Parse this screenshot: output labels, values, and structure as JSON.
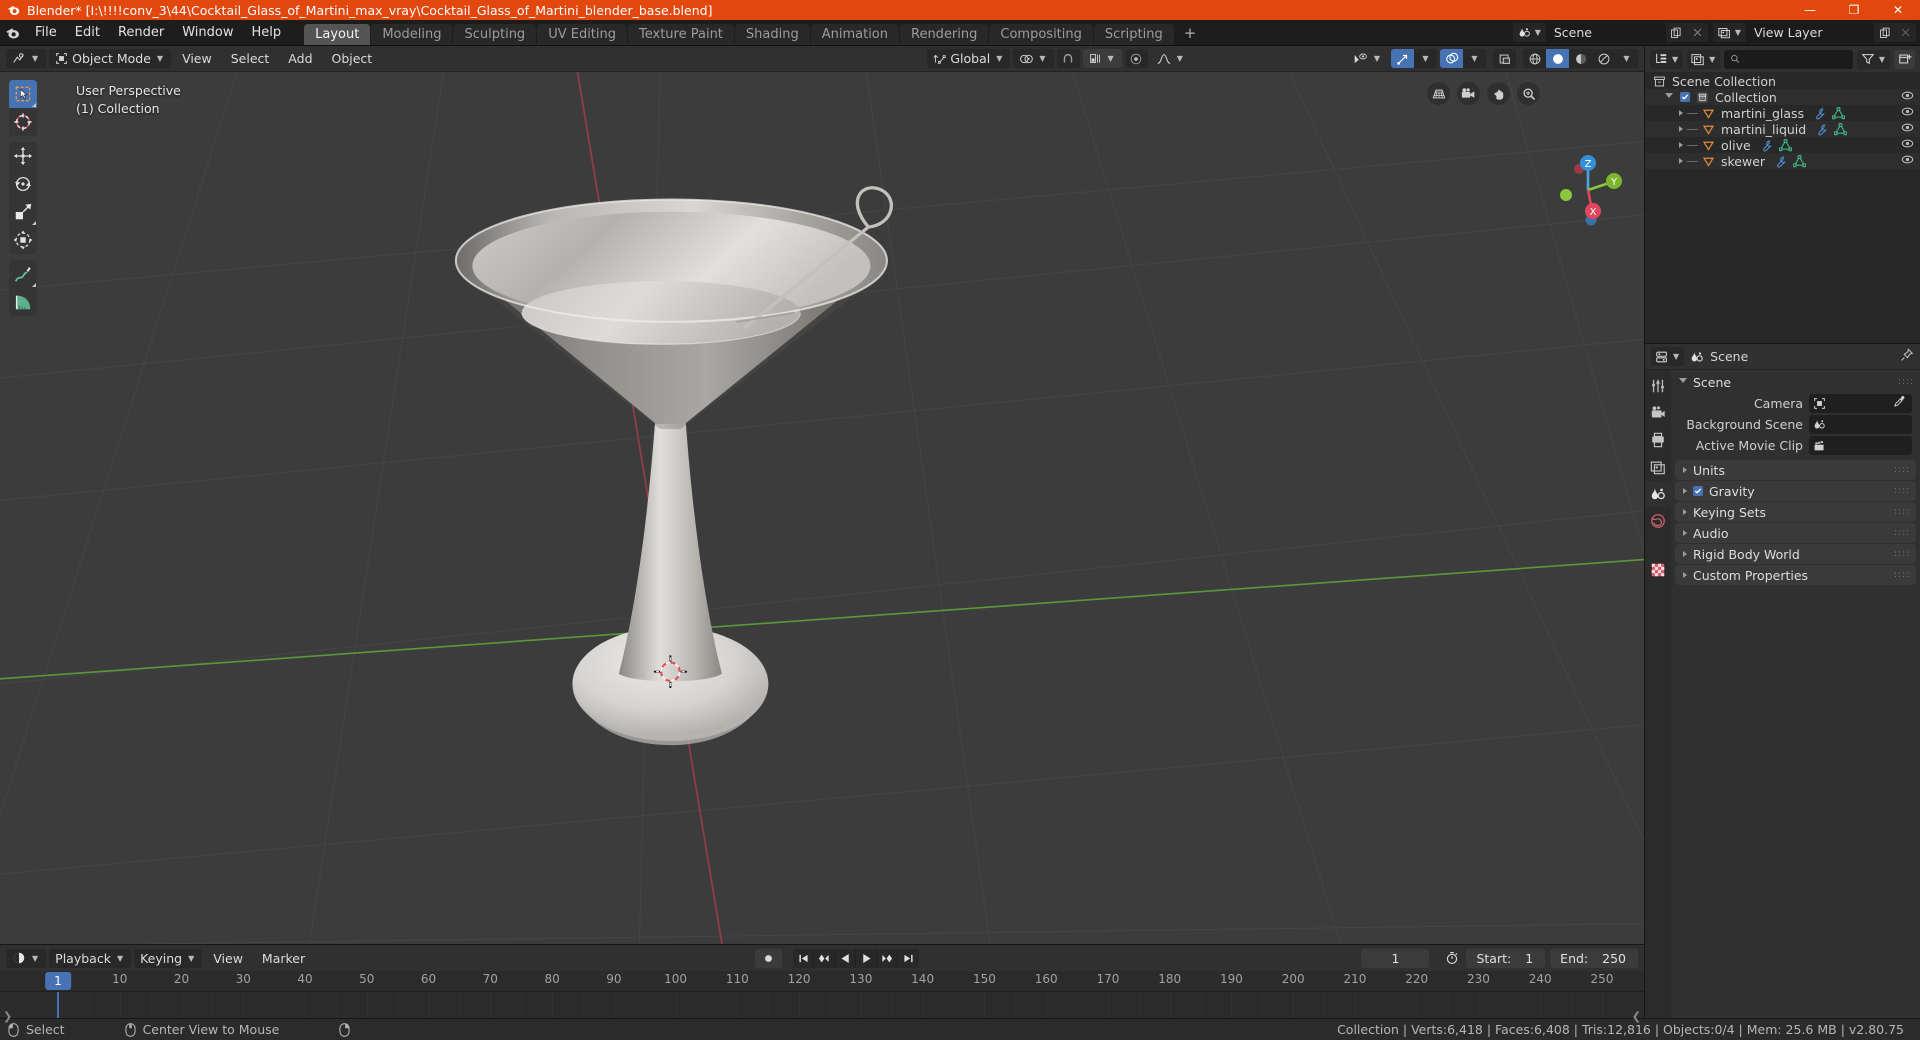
{
  "window": {
    "title": "Blender* [I:\\!!!!conv_3\\44\\Cocktail_Glass_of_Martini_max_vray\\Cocktail_Glass_of_Martini_blender_base.blend]",
    "minimize": "—",
    "maximize": "❐",
    "close": "✕",
    "accent": "#e2470d"
  },
  "topbar": {
    "menus": [
      "File",
      "Edit",
      "Render",
      "Window",
      "Help"
    ],
    "workspaces": [
      {
        "label": "Layout",
        "active": true
      },
      {
        "label": "Modeling",
        "active": false
      },
      {
        "label": "Sculpting",
        "active": false
      },
      {
        "label": "UV Editing",
        "active": false
      },
      {
        "label": "Texture Paint",
        "active": false
      },
      {
        "label": "Shading",
        "active": false
      },
      {
        "label": "Animation",
        "active": false
      },
      {
        "label": "Rendering",
        "active": false
      },
      {
        "label": "Compositing",
        "active": false
      },
      {
        "label": "Scripting",
        "active": false
      }
    ],
    "add_workspace": "+",
    "scene_name": "Scene",
    "view_layer_name": "View Layer"
  },
  "viewport_header": {
    "mode": "Object Mode",
    "menus": [
      "View",
      "Select",
      "Add",
      "Object"
    ],
    "transform_orientation": "Global"
  },
  "viewport": {
    "perspective_label": "User Perspective",
    "collection_label": "(1) Collection",
    "axis": {
      "z": "Z",
      "y": "Y",
      "x": "X"
    },
    "tools": [
      "select-box-tool",
      "cursor-tool",
      "move-tool",
      "rotate-tool",
      "scale-tool",
      "transform-tool",
      "annotate-tool",
      "measure-tool"
    ],
    "nav_icons": [
      "grid-toggle-icon",
      "camera-view-icon",
      "pan-view-icon",
      "zoom-view-icon"
    ]
  },
  "outliner": {
    "search_placeholder": "",
    "display_mode": "view-layer-icon",
    "rows": [
      {
        "label": "Scene Collection",
        "indent": 0,
        "icon": "collection-icon",
        "has_tri": false,
        "has_check": false,
        "eye": false,
        "data_icons": []
      },
      {
        "label": "Collection",
        "indent": 1,
        "icon": "collection-icon",
        "has_tri": true,
        "tri_down": true,
        "has_check": true,
        "eye": true,
        "data_icons": []
      },
      {
        "label": "martini_glass",
        "indent": 2,
        "icon": "object-mesh-icon",
        "has_tri": true,
        "tri_down": false,
        "has_check": false,
        "eye": true,
        "data_icons": [
          "modifier-icon",
          "mesh-data-icon"
        ]
      },
      {
        "label": "martini_liquid",
        "indent": 2,
        "icon": "object-mesh-icon",
        "has_tri": true,
        "tri_down": false,
        "has_check": false,
        "eye": true,
        "data_icons": [
          "modifier-icon",
          "mesh-data-icon"
        ]
      },
      {
        "label": "olive",
        "indent": 2,
        "icon": "object-mesh-icon",
        "has_tri": true,
        "tri_down": false,
        "has_check": false,
        "eye": true,
        "data_icons": [
          "modifier-icon",
          "mesh-data-icon"
        ]
      },
      {
        "label": "skewer",
        "indent": 2,
        "icon": "object-mesh-icon",
        "has_tri": true,
        "tri_down": false,
        "has_check": false,
        "eye": true,
        "data_icons": [
          "modifier-icon",
          "mesh-data-icon"
        ]
      }
    ]
  },
  "properties": {
    "breadcrumb": "Scene",
    "tabs": [
      "tool-tab",
      "render-tab",
      "output-tab",
      "view-layer-tab",
      "scene-tab",
      "world-tab",
      "texture-tab"
    ],
    "active_tab_index": 4,
    "scene_panel_title": "Scene",
    "fields": [
      {
        "label": "Camera",
        "value": "",
        "icon": "camera-object-icon",
        "pipette": true
      },
      {
        "label": "Background Scene",
        "value": "",
        "icon": "scene-icon",
        "pipette": false
      },
      {
        "label": "Active Movie Clip",
        "value": "",
        "icon": "clip-icon",
        "pipette": false
      }
    ],
    "panels": [
      {
        "label": "Units",
        "checkbox": false
      },
      {
        "label": "Gravity",
        "checkbox": true,
        "checked": true
      },
      {
        "label": "Keying Sets",
        "checkbox": false
      },
      {
        "label": "Audio",
        "checkbox": false
      },
      {
        "label": "Rigid Body World",
        "checkbox": false
      },
      {
        "label": "Custom Properties",
        "checkbox": false
      }
    ]
  },
  "timeline": {
    "menus": [
      "Playback",
      "Keying",
      "View",
      "Marker"
    ],
    "current_frame": "1",
    "start_label": "Start:",
    "start_value": "1",
    "end_label": "End:",
    "end_value": "250",
    "ruler_ticks": [
      "1",
      "10",
      "20",
      "30",
      "40",
      "50",
      "60",
      "70",
      "80",
      "90",
      "100",
      "110",
      "120",
      "130",
      "140",
      "150",
      "160",
      "170",
      "180",
      "190",
      "200",
      "210",
      "220",
      "230",
      "240",
      "250"
    ],
    "playhead_frame": "1",
    "transport": [
      "jump-start-icon",
      "prev-keyframe-icon",
      "play-reverse-icon",
      "play-icon",
      "next-keyframe-icon",
      "jump-end-icon"
    ],
    "record_icon": "record-icon"
  },
  "statusbar": {
    "left_items": [
      {
        "icon": "mouse-left-icon",
        "label": "Select"
      },
      {
        "icon": "mouse-middle-icon",
        "label": "Center View to Mouse"
      },
      {
        "icon": "mouse-right-icon",
        "label": ""
      }
    ],
    "stats": "Collection | Verts:6,418 | Faces:6,408 | Tris:12,816 | Objects:0/4 | Mem: 25.6 MB | v2.80.75"
  }
}
